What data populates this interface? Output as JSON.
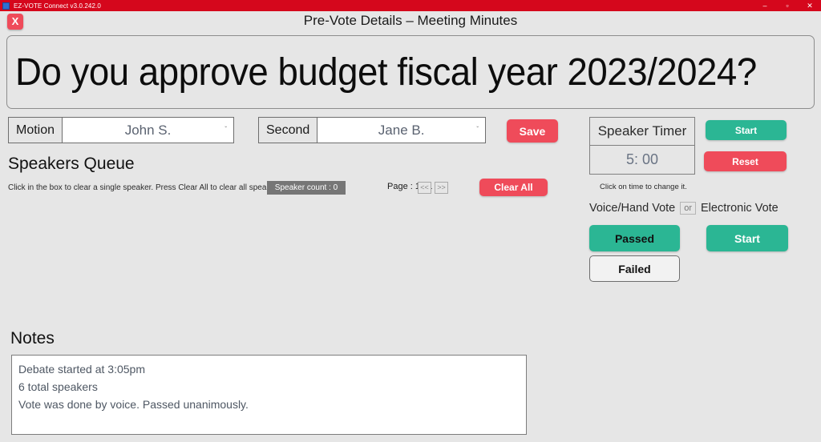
{
  "window": {
    "app_title": "EZ-VOTE Connect v3.0.242.0",
    "minimize": "–",
    "maximize": "▫",
    "close": "✕",
    "accent_red": "#d5071c"
  },
  "header": {
    "close_x_label": "X",
    "page_title": "Pre-Vote Details – Meeting Minutes"
  },
  "question": {
    "text": "Do you approve budget fiscal year 2023/2024?"
  },
  "motion": {
    "label": "Motion",
    "value": "John S.",
    "caret": "ˇ"
  },
  "second": {
    "label": "Second",
    "value": "Jane B.",
    "caret": "ˇ"
  },
  "toolbar": {
    "save_label": "Save"
  },
  "speakers_queue": {
    "title": "Speakers Queue",
    "hint": "Click in the box to clear a single speaker. Press Clear All to clear all speakers.",
    "speaker_count_label": "Speaker count :   0",
    "page_label": "Page : 1 / 1",
    "prev_label": "<<",
    "next_label": ">>",
    "clear_all_label": "Clear All"
  },
  "speaker_timer": {
    "title": "Speaker Timer",
    "time": "5: 00",
    "hint": "Click on time to change it.",
    "start_label": "Start",
    "reset_label": "Reset"
  },
  "vote": {
    "voice_label": "Voice/Hand Vote",
    "or_label": "or",
    "electronic_label": "Electronic Vote",
    "passed_label": "Passed",
    "failed_label": "Failed",
    "start_label": "Start",
    "green": "#2bb694",
    "red": "#ef4b5a"
  },
  "notes": {
    "title": "Notes",
    "lines": [
      "Debate started at 3:05pm",
      "6 total speakers",
      "Vote was done by voice. Passed unanimously."
    ]
  }
}
